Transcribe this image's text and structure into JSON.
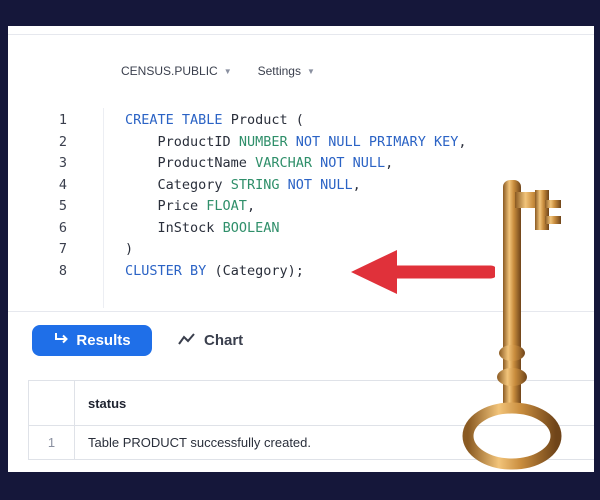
{
  "context": {
    "database": "CENSUS.PUBLIC",
    "settings": "Settings"
  },
  "editor": {
    "lines": [
      {
        "n": "1",
        "code": "CREATE TABLE Product ("
      },
      {
        "n": "2",
        "code": "    ProductID NUMBER NOT NULL PRIMARY KEY,"
      },
      {
        "n": "3",
        "code": "    ProductName VARCHAR NOT NULL,"
      },
      {
        "n": "4",
        "code": "    Category STRING NOT NULL,"
      },
      {
        "n": "5",
        "code": "    Price FLOAT,"
      },
      {
        "n": "6",
        "code": "    InStock BOOLEAN"
      },
      {
        "n": "7",
        "code": ")"
      },
      {
        "n": "8",
        "code": "CLUSTER BY (Category);"
      }
    ]
  },
  "tabs": {
    "results": "Results",
    "chart": "Chart"
  },
  "table": {
    "header": "status",
    "rows": [
      {
        "index": "1",
        "status": "Table PRODUCT successfully created."
      }
    ]
  },
  "colors": {
    "background": "#15173a",
    "accent": "#1f6fe8",
    "arrow": "#e0313a",
    "keyword": "#2b63c5",
    "type": "#2f8f6a"
  },
  "icons": {
    "results": "return-arrow-icon",
    "chart": "trend-line-icon",
    "caret": "caret-down-icon",
    "overlay_arrow": "left-arrow-icon",
    "overlay_key": "key-icon"
  }
}
